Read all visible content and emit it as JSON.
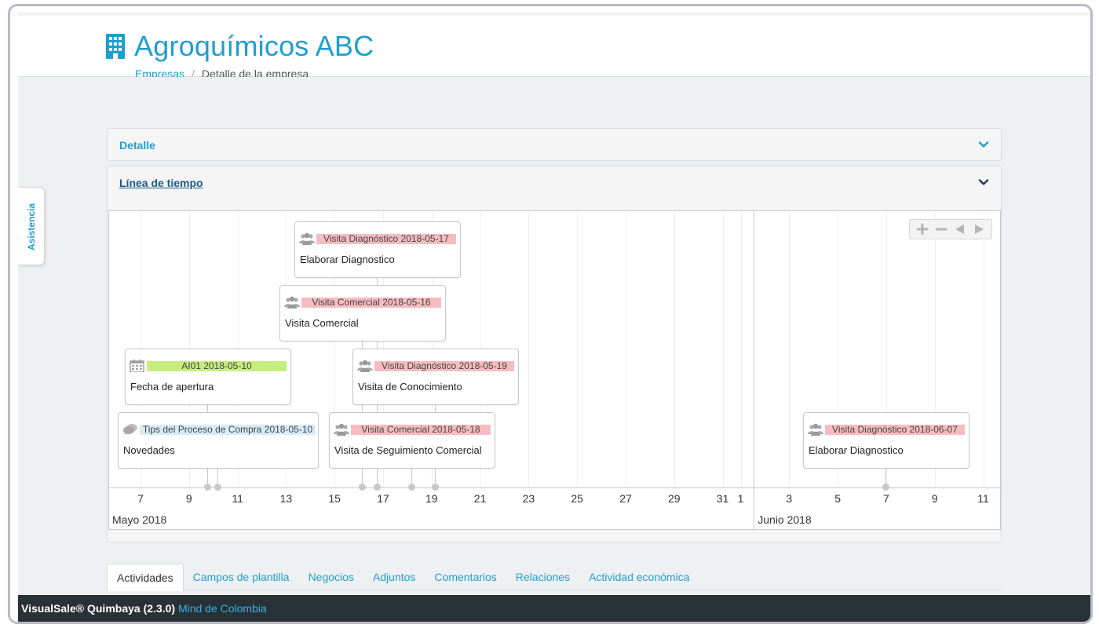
{
  "header": {
    "title": "Agroquímicos ABC",
    "breadcrumb": {
      "link": "Empresas",
      "separator": "/",
      "current": "Detalle de la empresa"
    }
  },
  "side_tab": {
    "label": "Asistencia"
  },
  "panels": {
    "detail": {
      "title": "Detalle"
    },
    "timeline": {
      "title": "Línea de tiempo"
    }
  },
  "timeline": {
    "months": [
      {
        "label": "Mayo 2018",
        "ticks": [
          "7",
          "9",
          "11",
          "13",
          "15",
          "17",
          "19",
          "21",
          "23",
          "25",
          "27",
          "29",
          "31"
        ]
      },
      {
        "label": "Junio 2018",
        "ticks": [
          "1",
          "3",
          "5",
          "7",
          "9",
          "11"
        ]
      }
    ],
    "events": [
      {
        "id": "e1",
        "icon": "users-icon",
        "tag": "Visita Diagnóstico 2018-05-17",
        "tag_color": "#f7bcc1",
        "body": "Elaborar Diagnostico"
      },
      {
        "id": "e2",
        "icon": "users-icon",
        "tag": "Visita Comercial 2018-05-16",
        "tag_color": "#f7bcc1",
        "body": "Visita Comercial"
      },
      {
        "id": "e3",
        "icon": "calendar-icon",
        "tag": "AI01 2018-05-10",
        "tag_color": "#c6ee7e",
        "body": "Fecha de apertura"
      },
      {
        "id": "e4",
        "icon": "users-icon",
        "tag": "Visita Diagnóstico 2018-05-19",
        "tag_color": "#f7bcc1",
        "body": "Visita de Conocimiento"
      },
      {
        "id": "e5",
        "icon": "comment-icon",
        "tag": "Tips del Proceso de Compra 2018-05-10",
        "tag_color": "#d6ecf7",
        "body": "Novedades"
      },
      {
        "id": "e6",
        "icon": "users-icon",
        "tag": "Visita Comercial 2018-05-18",
        "tag_color": "#f7bcc1",
        "body": "Visita de Seguimiento Comercial"
      },
      {
        "id": "e7",
        "icon": "users-icon",
        "tag": "Visita Diagnóstico 2018-06-07",
        "tag_color": "#f7bcc1",
        "body": "Elaborar Diagnostico"
      }
    ]
  },
  "tabs": [
    {
      "label": "Actividades",
      "active": true
    },
    {
      "label": "Campos de plantilla",
      "active": false
    },
    {
      "label": "Negocios",
      "active": false
    },
    {
      "label": "Adjuntos",
      "active": false
    },
    {
      "label": "Comentarios",
      "active": false
    },
    {
      "label": "Relaciones",
      "active": false
    },
    {
      "label": "Actividad económica",
      "active": false
    }
  ],
  "footer": {
    "brand": "VisualSale® Quimbaya (2.3.0)",
    "company": "Mind de Colombia"
  },
  "colors": {
    "accent": "#1e9fd0",
    "footer_bg": "#283135"
  }
}
